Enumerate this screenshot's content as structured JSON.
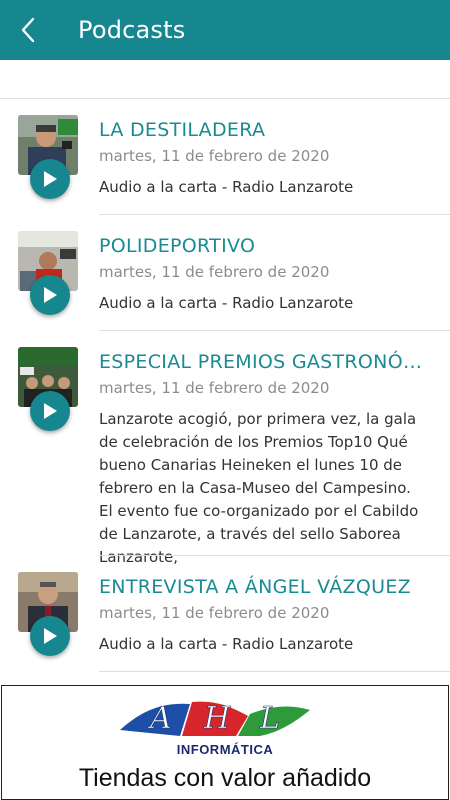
{
  "header": {
    "title": "Podcasts",
    "back_icon": "chevron-left-icon",
    "background": "#16878f"
  },
  "podcasts": [
    {
      "title": "LA DESTILADERA",
      "date": "martes, 11 de febrero de 2020",
      "description": "Audio a la carta - Radio Lanzarote"
    },
    {
      "title": "POLIDEPORTIVO",
      "date": "martes, 11 de febrero de 2020",
      "description": "Audio a la carta - Radio Lanzarote"
    },
    {
      "title": "ESPECIAL PREMIOS GASTRONÓMIC…",
      "date": "martes, 11 de febrero de 2020",
      "description": "Lanzarote acogió, por primera vez, la gala de celebración de los Premios Top10 Qué bueno Canarias Heineken el lunes 10 de febrero en la Casa-Museo del Campesino. El evento fue co-organizado por el Cabildo de Lanzarote, a través del sello Saborea Lanzarote,"
    },
    {
      "title": "ENTREVISTA A ÁNGEL VÁZQUEZ",
      "date": "martes, 11 de febrero de 2020",
      "description": "Audio a la carta - Radio Lanzarote"
    }
  ],
  "banner": {
    "logo_text": "AHL",
    "brand": "INFORMÁTICA",
    "slogan": "Tiendas con valor añadido"
  },
  "colors": {
    "accent": "#16878f",
    "title_text": "#1a8a93",
    "date_text": "#8c8c8c",
    "logo_red": "#d6262b",
    "logo_blue": "#1e4fa8",
    "logo_green": "#2e9a3a"
  }
}
